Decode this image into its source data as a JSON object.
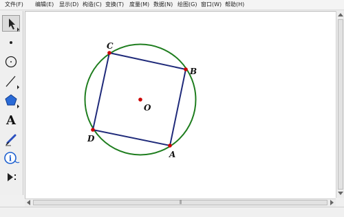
{
  "menu": [
    {
      "label": "文件(F)"
    },
    {
      "label": "编辑(E)"
    },
    {
      "label": "显示(D)"
    },
    {
      "label": "构造(C)"
    },
    {
      "label": "变换(T)"
    },
    {
      "label": "度量(M)"
    },
    {
      "label": "数据(N)"
    },
    {
      "label": "绘图(G)"
    },
    {
      "label": "窗口(W)"
    },
    {
      "label": "帮助(H)"
    }
  ],
  "tools": [
    {
      "name": "arrow-tool",
      "label": "Arrow"
    },
    {
      "name": "point-tool",
      "label": "Point"
    },
    {
      "name": "compass-tool",
      "label": "Compass"
    },
    {
      "name": "straightedge-tool",
      "label": "Straightedge"
    },
    {
      "name": "polygon-tool",
      "label": "Polygon"
    },
    {
      "name": "text-tool",
      "label": "A"
    },
    {
      "name": "marker-tool",
      "label": "Marker"
    },
    {
      "name": "information-tool",
      "label": "i"
    },
    {
      "name": "custom-tool",
      "label": "Custom"
    }
  ],
  "figure": {
    "point_labels": {
      "A": "A",
      "B": "B",
      "C": "C",
      "D": "D",
      "O": "O"
    },
    "colors": {
      "circle": "#1e7d1e",
      "square": "#1f2a7a",
      "point": "#cc0000",
      "label": "#111111"
    }
  },
  "scrollbar_grip": "|||"
}
